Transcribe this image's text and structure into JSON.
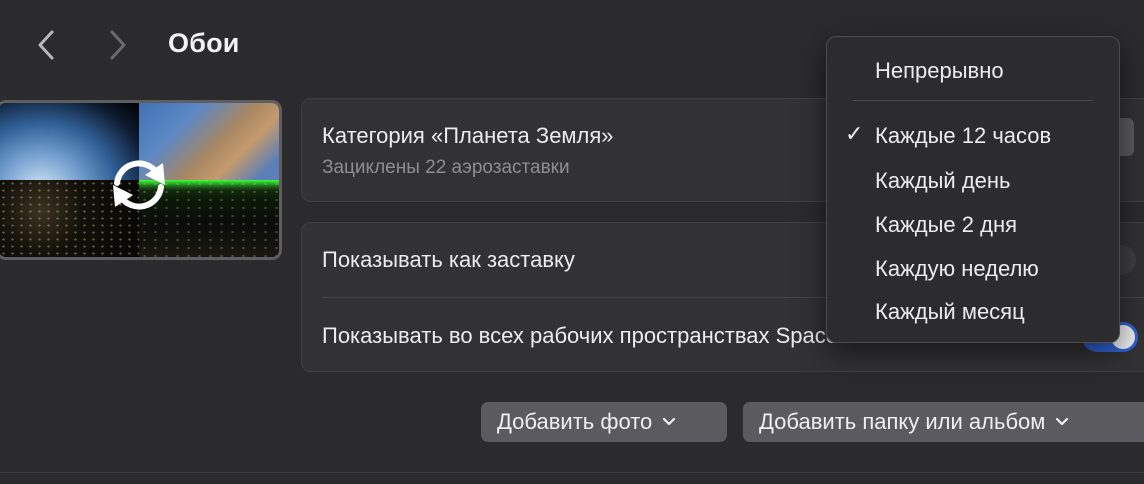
{
  "header": {
    "title": "Обои",
    "back_icon": "chevron-left-icon",
    "forward_icon": "chevron-right-icon"
  },
  "wallpaper": {
    "overlay_icon": "rotate-arrows-icon"
  },
  "category": {
    "title": "Категория «Планета Земля»",
    "subtitle": "Зациклены 22 аэрозаставки"
  },
  "options": {
    "show_as_screensaver": "Показывать как заставку",
    "show_all_spaces": "Показывать во всех рабочих пространствах Spaces",
    "show_all_spaces_enabled": true
  },
  "buttons": {
    "add_photo": "Добавить фото",
    "add_folder": "Добавить папку или альбом"
  },
  "menu": {
    "items": [
      "Непрерывно",
      "Каждые 12 часов",
      "Каждый день",
      "Каждые 2 дня",
      "Каждую неделю",
      "Каждый месяц"
    ],
    "checked": "Каждые 12 часов",
    "check_mark": "✓"
  },
  "colors": {
    "accent": "#2f63d3",
    "background": "#2b2b2d"
  }
}
